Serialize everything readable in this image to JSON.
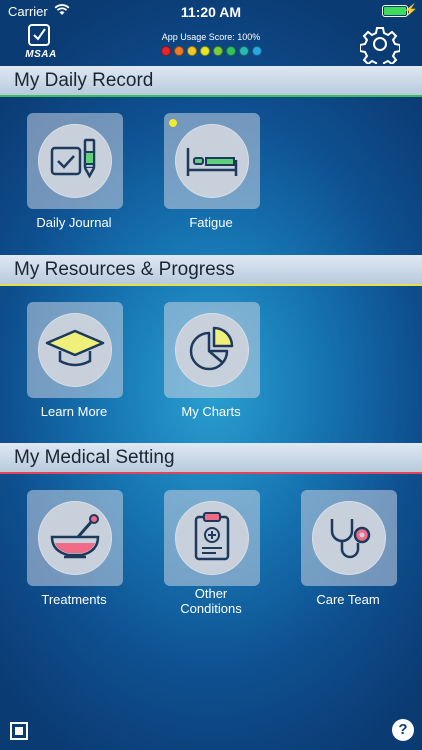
{
  "status_bar": {
    "carrier": "Carrier",
    "time": "11:20 AM"
  },
  "header": {
    "logo_text": "MSAA",
    "usage_score": "App Usage Score: 100%",
    "usage_dot_colors": [
      "#e8262a",
      "#f07a24",
      "#f2c529",
      "#e8e42a",
      "#7ccf3b",
      "#2fc45a",
      "#27b8b0",
      "#2aa7e0"
    ]
  },
  "sections": [
    {
      "title": "My Daily Record",
      "accent": "#3cbf5a"
    },
    {
      "title": "My Resources & Progress",
      "accent": "#e7df4a"
    },
    {
      "title": "My Medical Setting",
      "accent": "#e0455a"
    }
  ],
  "tiles": {
    "daily_journal": "Daily Journal",
    "fatigue": "Fatigue",
    "learn_more": "Learn More",
    "my_charts": "My Charts",
    "treatments": "Treatments",
    "other_conditions": "Other\nConditions",
    "care_team": "Care Team"
  },
  "footer": {
    "help": "?"
  },
  "icons": {
    "daily_journal": "checkbox-pencil-icon",
    "fatigue": "bed-icon",
    "learn_more": "graduation-cap-icon",
    "my_charts": "pie-chart-icon",
    "treatments": "mortar-pestle-icon",
    "other_conditions": "clipboard-medical-icon",
    "care_team": "stethoscope-icon"
  }
}
